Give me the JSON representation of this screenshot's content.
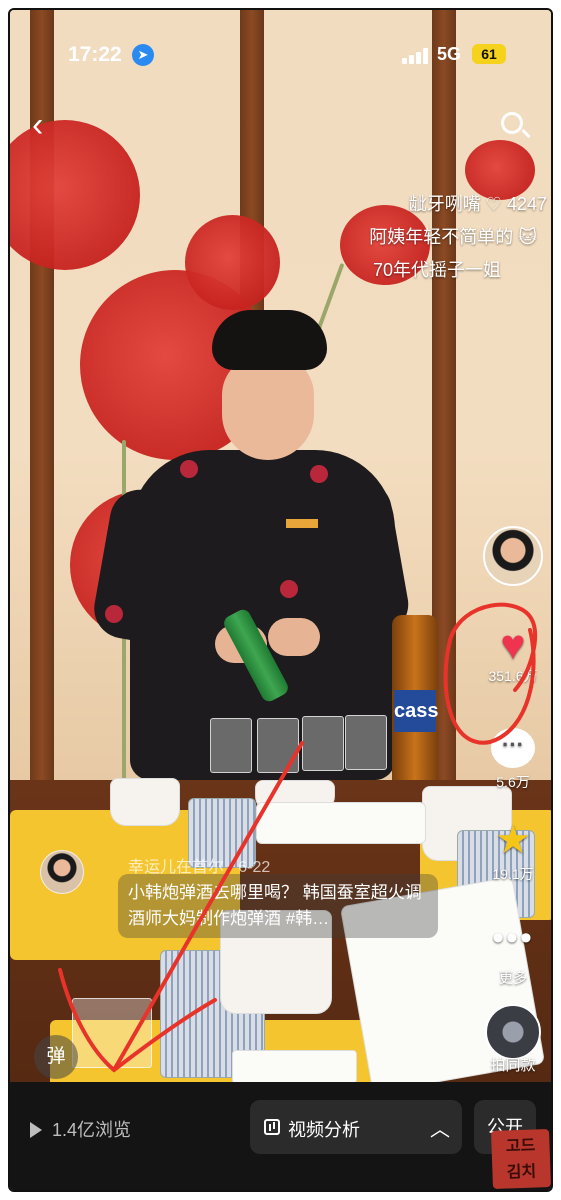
{
  "status_bar": {
    "time": "17:22",
    "network": "5G",
    "battery": "61",
    "location_icon": "location-arrow-icon",
    "signal_icon": "signal-bars-icon"
  },
  "top_bar": {
    "back_icon": "chevron-left-icon",
    "search_icon": "search-icon"
  },
  "danmaku": [
    {
      "text": "龇牙咧嘴",
      "likes": "4247"
    },
    {
      "text": "阿姨年轻不简单的"
    },
    {
      "text": "70年代摇子一姐"
    }
  ],
  "side_actions": {
    "like_count": "351.6万",
    "comment_count": "5.6万",
    "favorite_count": "19.1万",
    "more_label": "更多",
    "same_style_label": "拍同款"
  },
  "video_info": {
    "author_line": "幸运儿在首尔 · 6-22",
    "caption": "小韩炮弹酒去哪里喝？ 韩国蚕室超火调酒师大妈制作炮弹酒 #韩…",
    "danmaku_button": "弹"
  },
  "bottom_bar": {
    "views": "1.4亿浏览",
    "analysis_label": "视频分析",
    "public_label": "公开"
  },
  "scene_text": {
    "beer_label": "cass"
  },
  "watermark": {
    "line1": "고드",
    "line2": "김치"
  },
  "colors": {
    "like_red": "#f0334e",
    "favorite_yellow": "#f5c518",
    "annotation_red": "#e8332b",
    "bottom_bar_bg": "#141414"
  }
}
